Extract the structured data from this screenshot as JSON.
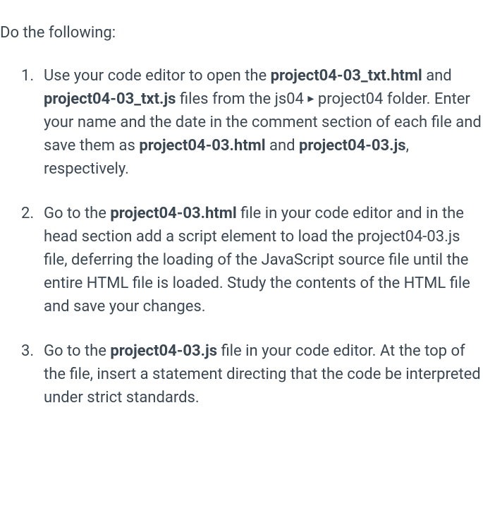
{
  "intro": "Do the following:",
  "items": [
    {
      "segments": [
        {
          "text": "Use your code editor to open the "
        },
        {
          "text": "project04-03_txt.html",
          "bold": true
        },
        {
          "text": " and "
        },
        {
          "text": "project04-03_txt.js",
          "bold": true
        },
        {
          "text": " files from the js04 "
        },
        {
          "text": "▸",
          "arrow": true
        },
        {
          "text": " project04 folder. Enter your name and the date in the comment section of each file and save them as "
        },
        {
          "text": "project04-03.html",
          "bold": true
        },
        {
          "text": " and "
        },
        {
          "text": "project04-03.js",
          "bold": true
        },
        {
          "text": ", respectively."
        }
      ]
    },
    {
      "segments": [
        {
          "text": "Go to the "
        },
        {
          "text": "project04-03.html",
          "bold": true
        },
        {
          "text": " file in your code editor and in the head section add a script element to load the project04-03.js file, deferring the loading of the JavaScript source file until the entire HTML file is loaded. Study the contents of the HTML file and save your changes."
        }
      ]
    },
    {
      "segments": [
        {
          "text": "Go to the "
        },
        {
          "text": "project04-03.js",
          "bold": true
        },
        {
          "text": " file in your code editor. At the top of the file, insert a statement directing that the code be interpreted under strict standards."
        }
      ]
    }
  ]
}
